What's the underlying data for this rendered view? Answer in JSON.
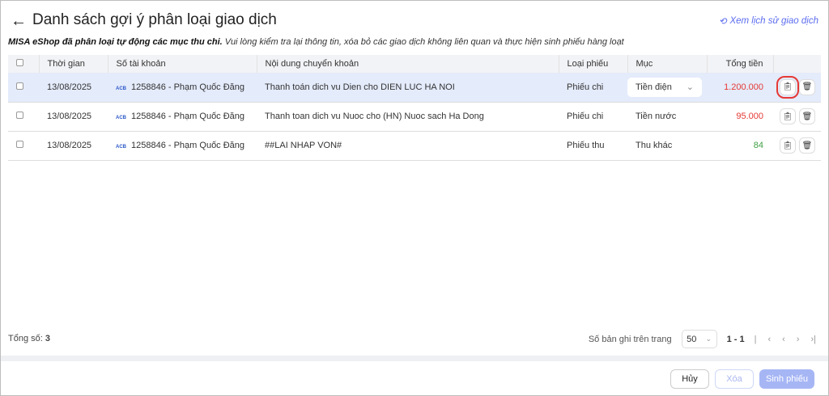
{
  "header": {
    "back_icon": "arrow-left-icon",
    "title": "Danh sách gợi ý phân loại giao dịch",
    "history_link": "Xem lịch sử giao dịch"
  },
  "subtitle": {
    "bold": "MISA eShop đã phân loại tự động các mục thu chi.",
    "rest": " Vui lòng kiểm tra lại thông tin, xóa bỏ các giao dịch không liên quan và thực hiện sinh phiếu hàng loạt"
  },
  "table": {
    "columns": [
      "Thời gian",
      "Số tài khoản",
      "Nội dung chuyển khoản",
      "Loại phiếu",
      "Mục",
      "Tổng tiền"
    ],
    "rows": [
      {
        "date": "13/08/2025",
        "bank": "ACB",
        "account": "1258846 - Phạm Quốc Đăng",
        "content": "Thanh toán dich vu Dien cho DIEN LUC HA NOI",
        "type": "Phiếu chi",
        "category": "Tiền điện",
        "amount": "1.200.000"
      },
      {
        "date": "13/08/2025",
        "bank": "ACB",
        "account": "1258846 - Phạm Quốc Đăng",
        "content": "Thanh toan dich vu Nuoc cho (HN) Nuoc sach Ha Dong",
        "type": "Phiếu chi",
        "category": "Tiền nước",
        "amount": "95.000"
      },
      {
        "date": "13/08/2025",
        "bank": "ACB",
        "account": "1258846 - Phạm Quốc Đăng",
        "content": "##LAI NHAP VON#",
        "type": "Phiếu thu",
        "category": "Thu khác",
        "amount": "84"
      }
    ]
  },
  "footer": {
    "total_label": "Tổng số:",
    "total": "3",
    "per_page_label": "Số bản ghi trên trang",
    "per_page": "50",
    "range": "1 - 1"
  },
  "actions": {
    "cancel": "Hủy",
    "delete": "Xóa",
    "generate": "Sinh phiếu"
  },
  "colors": {
    "expense": "#e53935",
    "income": "#43a047",
    "accent": "#5b6cf0"
  }
}
